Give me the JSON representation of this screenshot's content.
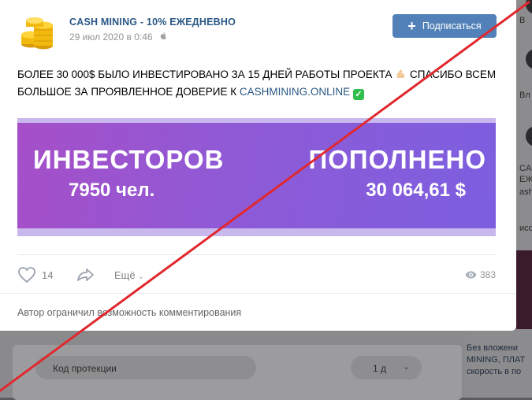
{
  "post": {
    "group_name": "CASH MINING - 10% ЕЖЕДНЕВНО",
    "date": "29 июл 2020 в 0:46",
    "subscribe_label": "Подписаться",
    "text_part1": "БОЛЕЕ 30 000$ БЫЛО ИНВЕСТИРОВАНО ЗА 15 ДНЕЙ РАБОТЫ ПРОЕКТА",
    "text_part2": "СПАСИБО ВСЕМ БОЛЬШОЕ ЗА ПРОЯВЛЕННОЕ ДОВЕРИЕ К",
    "link": "CASHMINING.ONLINE",
    "banner": {
      "left_title": "ИНВЕСТОРОВ",
      "left_value": "7950 чел.",
      "right_title": "ПОПОЛНЕНО",
      "right_value": "30 064,61 $"
    },
    "likes": "14",
    "more_label": "Ещё",
    "views": "383",
    "comments_note": "Автор ограничил возможность комментирования",
    "colors": {
      "link": "#2a5885",
      "button": "#5181b8",
      "cross": "#e0282e"
    }
  },
  "background": {
    "field_label": "Код протекции",
    "select_value": "1 д",
    "side_texts": [
      "В",
      "Вл",
      "CASH",
      "ЕЖЕД",
      "ashm",
      "исси"
    ],
    "news_lines": [
      "Без вложени",
      "MINING, ПЛАТ",
      "скорость в по"
    ]
  }
}
